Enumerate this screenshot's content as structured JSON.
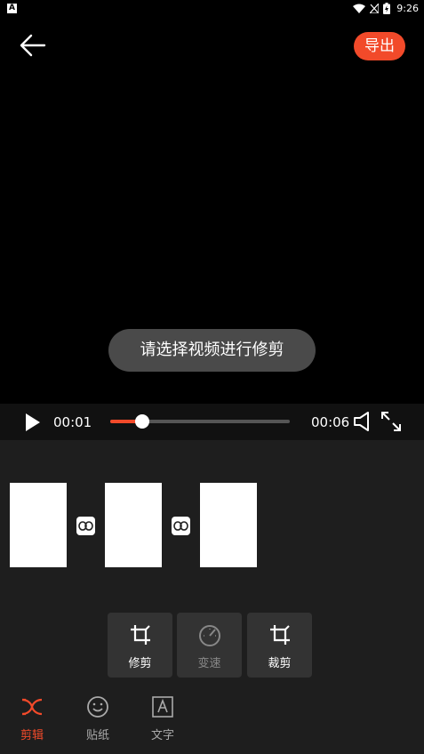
{
  "status_bar": {
    "app_icon": "A",
    "time": "9:26"
  },
  "header": {
    "export_label": "导出"
  },
  "video": {
    "toast": "请选择视频进行修剪"
  },
  "player": {
    "current_time": "00:01",
    "total_time": "00:06",
    "progress": 0.18
  },
  "tools": [
    {
      "label": "修剪",
      "icon": "trim-icon",
      "enabled": true
    },
    {
      "label": "变速",
      "icon": "speed-gauge-icon",
      "enabled": false
    },
    {
      "label": "裁剪",
      "icon": "crop-icon",
      "enabled": true
    }
  ],
  "tabs": [
    {
      "label": "剪辑",
      "icon": "scissors-icon",
      "active": true
    },
    {
      "label": "贴纸",
      "icon": "smiley-icon",
      "active": false
    },
    {
      "label": "文字",
      "icon": "text-a-icon",
      "active": false
    }
  ],
  "colors": {
    "accent": "#f24a2a",
    "panel": "#1e1e1e",
    "tool_bg": "#333333"
  }
}
